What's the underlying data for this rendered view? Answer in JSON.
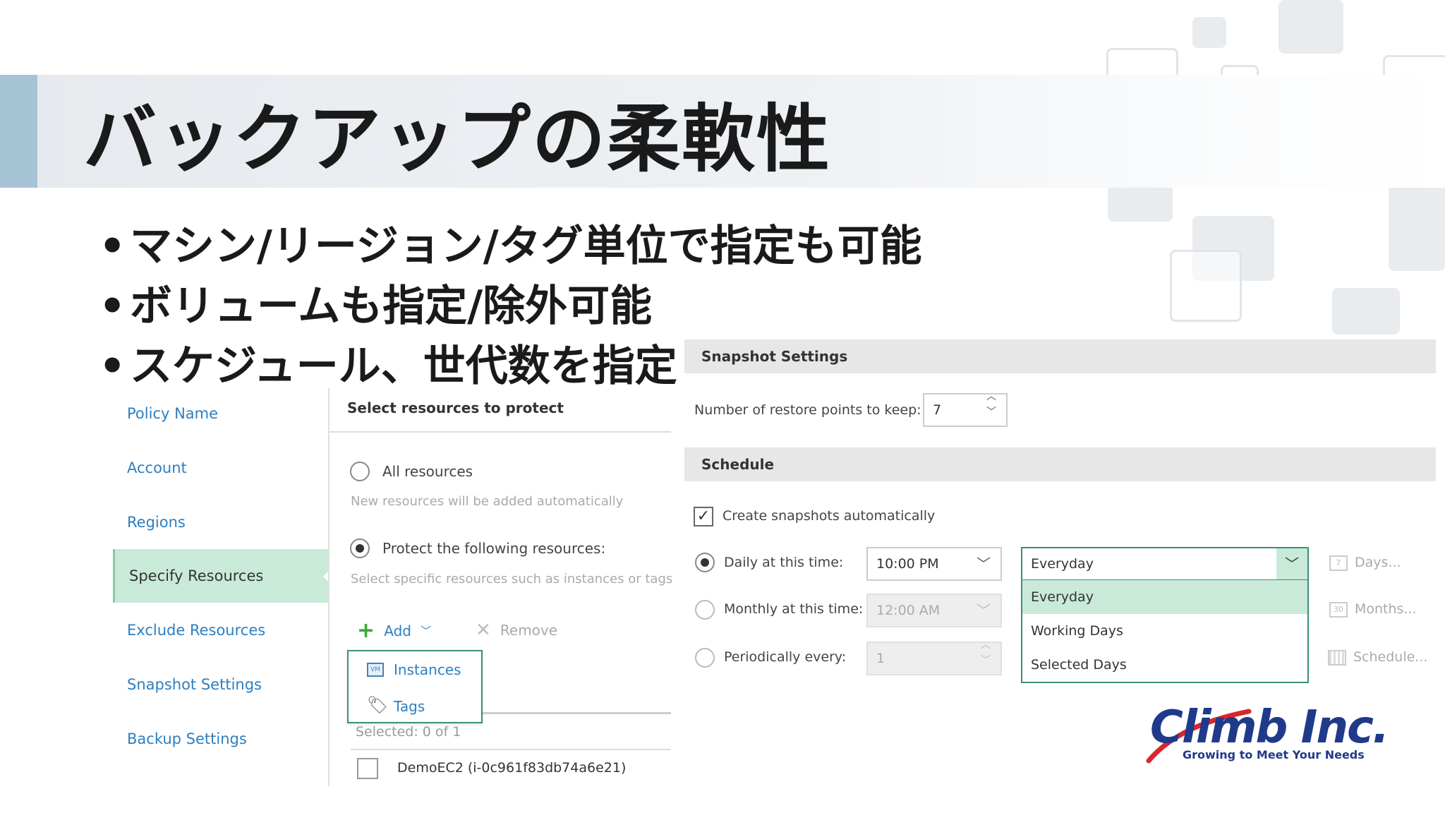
{
  "slide": {
    "title": "バックアップの柔軟性",
    "bullets": [
      "マシン/リージョン/タグ単位で指定も可能",
      "ボリュームも指定/除外可能",
      "スケジュール、世代数を指定"
    ]
  },
  "nav": {
    "items": [
      {
        "label": "Policy Name",
        "active": false
      },
      {
        "label": "Account",
        "active": false
      },
      {
        "label": "Regions",
        "active": false
      },
      {
        "label": "Specify Resources",
        "active": true
      },
      {
        "label": "Exclude Resources",
        "active": false
      },
      {
        "label": "Snapshot Settings",
        "active": false
      },
      {
        "label": "Backup Settings",
        "active": false
      }
    ]
  },
  "resources": {
    "heading": "Select resources to protect",
    "all_option": "All resources",
    "all_hint": "New resources will be added automatically",
    "protect_option": "Protect the following resources:",
    "protect_hint": "Select specific resources such as instances or tags",
    "add_label": "Add",
    "remove_label": "Remove",
    "add_menu": [
      {
        "label": "Instances",
        "icon": "instances-icon"
      },
      {
        "label": "Tags",
        "icon": "tag-icon"
      }
    ],
    "selected_text": "Selected:  0 of 1",
    "rows": [
      {
        "label": "DemoEC2 (i-0c961f83db74a6e21)",
        "checked": false
      }
    ]
  },
  "snapshot": {
    "section_title": "Snapshot Settings",
    "restore_points_label": "Number of restore points to keep:",
    "restore_points_value": "7",
    "schedule_title": "Schedule",
    "create_auto_label": "Create snapshots automatically",
    "create_auto_checked": true,
    "daily_label": "Daily at this time:",
    "daily_time": "10:00 PM",
    "monthly_label": "Monthly at this time:",
    "monthly_time": "12:00 AM",
    "periodic_label": "Periodically every:",
    "periodic_value": "1",
    "frequency_selected": "Everyday",
    "frequency_options": [
      "Everyday",
      "Working Days",
      "Selected Days"
    ],
    "days_link": "Days...",
    "months_link": "Months...",
    "schedule_link": "Schedule...",
    "days_icon_text": "7",
    "months_icon_text": "30"
  },
  "logo": {
    "name": "Climb Inc.",
    "tagline": "Growing to Meet Your Needs"
  },
  "colors": {
    "accent_blue": "#2d7fc1",
    "active_nav": "#c9ead9",
    "dropdown_highlight": "#c9ead9",
    "add_green": "#3aaa35",
    "logo_navy": "#1f3a8a",
    "logo_red": "#d9262c"
  }
}
